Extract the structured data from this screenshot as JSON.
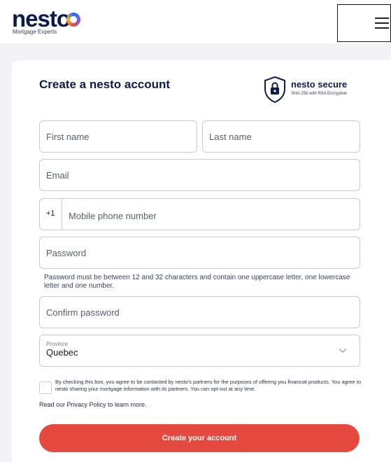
{
  "header": {
    "logo_word": "nesto",
    "logo_tagline": "Mortgage Experts",
    "menu_icon": "hamburger-menu-icon"
  },
  "form": {
    "title": "Create a nesto account",
    "secure_badge": {
      "title": "nesto secure",
      "subtitle": "SHA-256 with RSA Encryption",
      "icon": "shield-lock-icon"
    },
    "first_name_placeholder": "First name",
    "last_name_placeholder": "Last name",
    "email_placeholder": "Email",
    "phone_prefix": "+1",
    "phone_placeholder": "Mobile phone number",
    "password_placeholder": "Password",
    "password_hint": "Password must be between 12 and 32 characters and contain one uppercase letter, one lowercase letter and one number.",
    "confirm_password_placeholder": "Confirm password",
    "province_label": "Province",
    "province_value": "Quebec",
    "consent_text": "By checking this box, you agree to be contacted by nesto's partners for the purposes of offering you financial products. You agree to nesto sharing your mortgage information with its partners. You can opt-out at any time.",
    "privacy_text": "Read our Privacy Policy to learn more.",
    "submit_label": "Create your account"
  },
  "colors": {
    "brand_navy": "#0d1b4b",
    "cta_red": "#e64a3f",
    "page_bg": "#f4f4f6",
    "field_border": "#c9cbd3"
  }
}
